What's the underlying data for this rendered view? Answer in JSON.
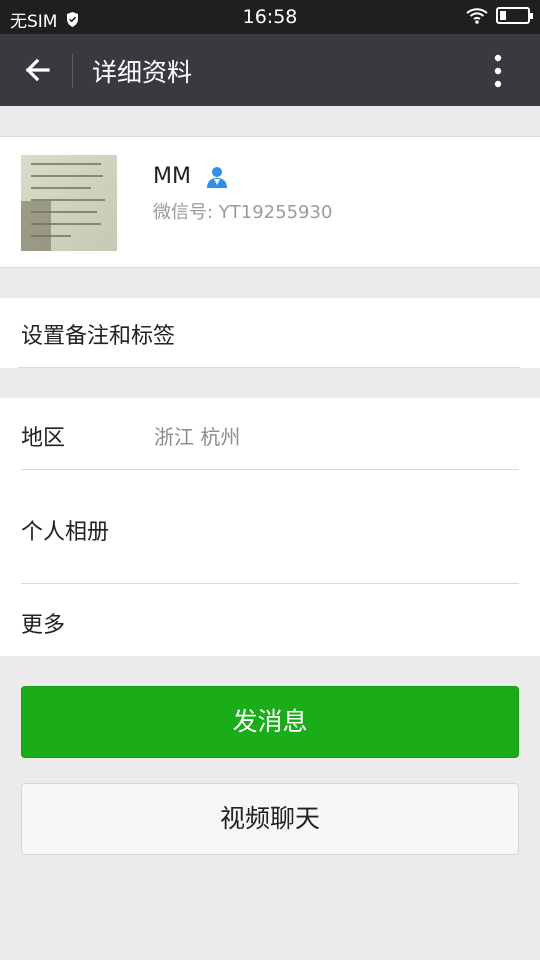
{
  "status_bar": {
    "carrier": "无SIM",
    "time": "16:58"
  },
  "header": {
    "title": "详细资料"
  },
  "profile": {
    "name": "MM",
    "wechat_id": "微信号: YT19255930"
  },
  "rows": {
    "remark": "设置备注和标签",
    "region_label": "地区",
    "region_value": "浙江  杭州",
    "album": "个人相册",
    "more": "更多"
  },
  "actions": {
    "send_message": "发消息",
    "video_chat": "视频聊天"
  },
  "colors": {
    "accent_green": "#1aad19",
    "app_bar": "#393a3f",
    "background": "#ebebeb"
  }
}
